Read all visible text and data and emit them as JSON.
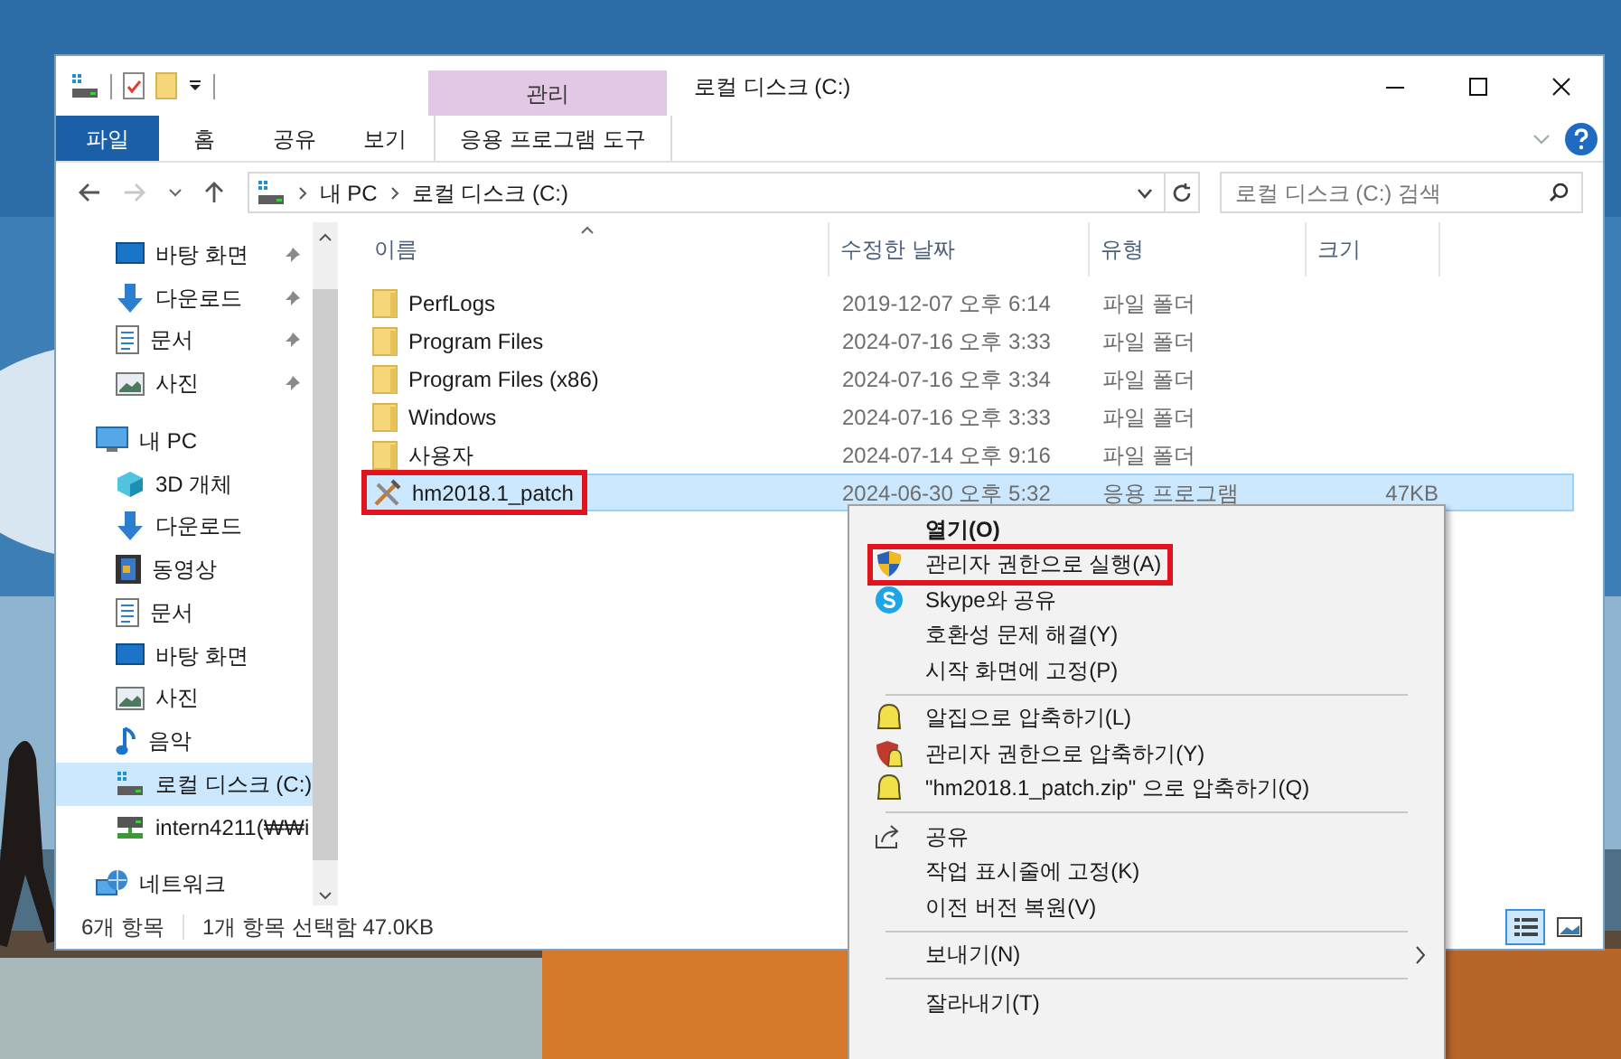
{
  "window": {
    "title": "로컬 디스크 (C:)",
    "context_group": "관리"
  },
  "ribbon_tabs": [
    {
      "label": "파일",
      "selected": true,
      "kind": "file"
    },
    {
      "label": "홈",
      "selected": false,
      "kind": "tab"
    },
    {
      "label": "공유",
      "selected": false,
      "kind": "tab"
    },
    {
      "label": "보기",
      "selected": false,
      "kind": "tab"
    },
    {
      "label": "응용 프로그램 도구",
      "selected": false,
      "kind": "context"
    }
  ],
  "address_bar": {
    "path": [
      "내 PC",
      "로컬 디스크 (C:)"
    ]
  },
  "search": {
    "placeholder": "로컬 디스크 (C:) 검색"
  },
  "sidebar": {
    "quick_access": [
      {
        "label": "바탕 화면",
        "kind": "desktop",
        "pinned": true
      },
      {
        "label": "다운로드",
        "kind": "download",
        "pinned": true
      },
      {
        "label": "문서",
        "kind": "document",
        "pinned": true
      },
      {
        "label": "사진",
        "kind": "picture",
        "pinned": true
      }
    ],
    "items": [
      {
        "label": "내 PC",
        "kind": "pc",
        "selected": false,
        "children": [
          {
            "label": "3D 개체",
            "kind": "cube",
            "selected": false
          },
          {
            "label": "다운로드",
            "kind": "download",
            "selected": false
          },
          {
            "label": "동영상",
            "kind": "video",
            "selected": false
          },
          {
            "label": "문서",
            "kind": "document",
            "selected": false
          },
          {
            "label": "바탕 화면",
            "kind": "desktop",
            "selected": false
          },
          {
            "label": "사진",
            "kind": "picture",
            "selected": false
          },
          {
            "label": "음악",
            "kind": "music",
            "selected": false
          },
          {
            "label": "로컬 디스크 (C:)",
            "kind": "drive",
            "selected": true
          },
          {
            "label": "intern4211(₩₩i",
            "kind": "netdrive",
            "selected": false
          }
        ]
      },
      {
        "label": "네트워크",
        "kind": "network",
        "selected": false
      }
    ]
  },
  "table": {
    "columns": [
      "이름",
      "수정한 날짜",
      "유형",
      "크기"
    ],
    "rows": [
      {
        "name": "PerfLogs",
        "modified": "2019-12-07 오후 6:14",
        "type": "파일 폴더",
        "kind": "folder",
        "selected": false,
        "highlighted": false
      },
      {
        "name": "Program Files",
        "modified": "2024-07-16 오후 3:33",
        "type": "파일 폴더",
        "kind": "folder",
        "selected": false,
        "highlighted": false
      },
      {
        "name": "Program Files (x86)",
        "modified": "2024-07-16 오후 3:34",
        "type": "파일 폴더",
        "kind": "folder",
        "selected": false,
        "highlighted": false
      },
      {
        "name": "Windows",
        "modified": "2024-07-16 오후 3:33",
        "type": "파일 폴더",
        "kind": "folder",
        "selected": false,
        "highlighted": false
      },
      {
        "name": "사용자",
        "modified": "2024-07-14 오후 9:16",
        "type": "파일 폴더",
        "kind": "folder",
        "selected": false,
        "highlighted": false
      },
      {
        "name": "hm2018.1_patch",
        "modified": "2024-06-30 오후 5:32",
        "type": "응용 프로그램",
        "size": "47KB",
        "kind": "app",
        "selected": true,
        "highlighted": true
      }
    ]
  },
  "context_menu": [
    [
      {
        "label": "열기(O)",
        "default": true,
        "highlighted": false
      },
      {
        "label": "관리자 권한으로 실행(A)",
        "kind": "shield",
        "default": false,
        "highlighted": true
      },
      {
        "label": "Skype와 공유",
        "kind": "skype",
        "default": false,
        "highlighted": false
      },
      {
        "label": "호환성 문제 해결(Y)",
        "default": false,
        "highlighted": false
      },
      {
        "label": "시작 화면에 고정(P)",
        "default": false,
        "highlighted": false
      }
    ],
    [
      {
        "label": "알집으로 압축하기(L)",
        "kind": "zip",
        "default": false,
        "highlighted": false
      },
      {
        "label": "관리자 권한으로 압축하기(Y)",
        "kind": "zipshield",
        "default": false,
        "highlighted": false
      },
      {
        "label": "\"hm2018.1_patch.zip\" 으로 압축하기(Q)",
        "kind": "zip",
        "default": false,
        "highlighted": false
      }
    ],
    [
      {
        "label": "공유",
        "kind": "share",
        "default": false,
        "highlighted": false
      },
      {
        "label": "작업 표시줄에 고정(K)",
        "default": false,
        "highlighted": false
      },
      {
        "label": "이전 버전 복원(V)",
        "default": false,
        "highlighted": false
      }
    ],
    [
      {
        "label": "보내기(N)",
        "submenu": true,
        "default": false,
        "highlighted": false
      }
    ],
    [
      {
        "label": "잘라내기(T)",
        "default": false,
        "highlighted": false
      }
    ]
  ],
  "status_bar": {
    "item_count": "6개 항목",
    "selection": "1개 항목 선택함 47.0KB",
    "views": [
      {
        "kind": "details",
        "selected": true
      },
      {
        "kind": "thumbnails",
        "selected": false
      }
    ]
  }
}
